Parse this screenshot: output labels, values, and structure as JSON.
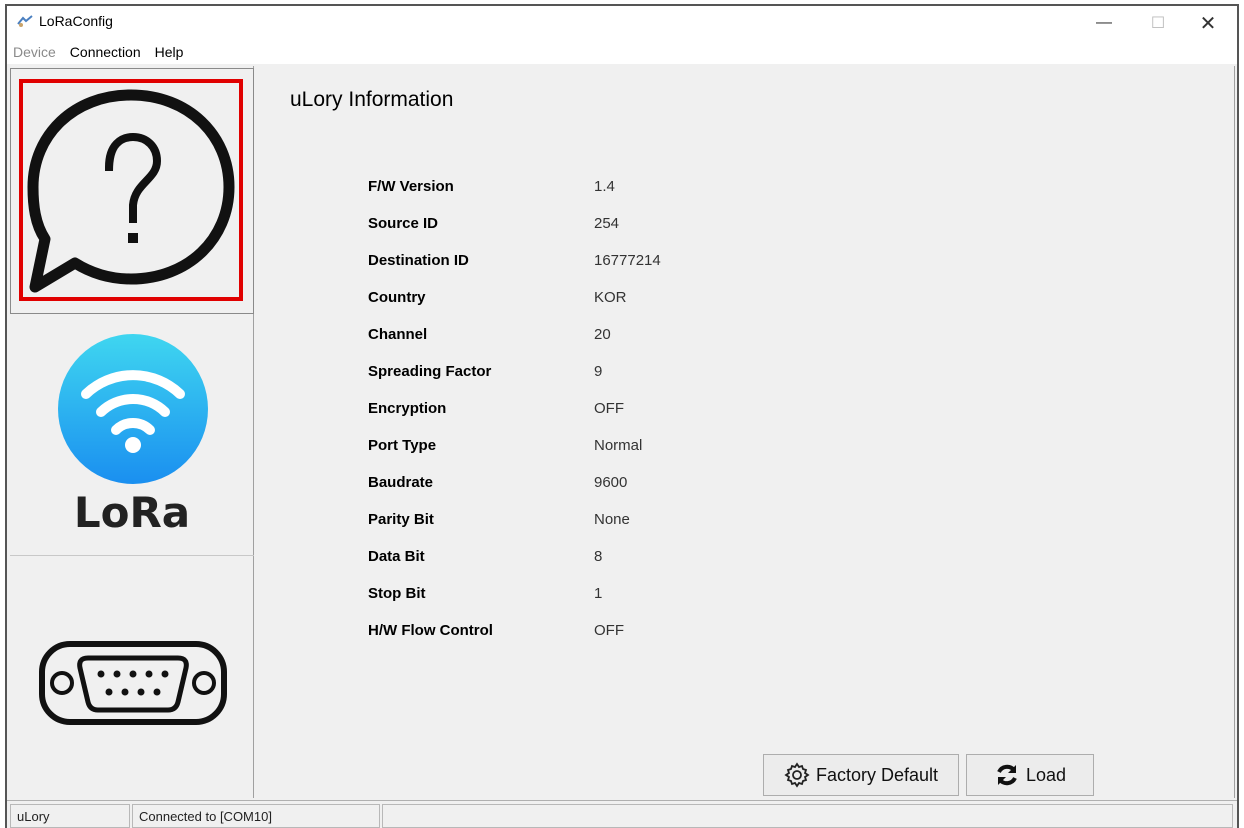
{
  "window": {
    "title": "LoRaConfig",
    "controls": {
      "minimize": "—",
      "maximize": "☐",
      "close": "✕"
    }
  },
  "menu": [
    {
      "label": "Device",
      "enabled": false
    },
    {
      "label": "Connection",
      "enabled": true
    },
    {
      "label": "Help",
      "enabled": true
    }
  ],
  "sidebar": {
    "items": [
      {
        "name": "help",
        "icon": "help-speech-bubble-icon",
        "selected": true
      },
      {
        "name": "lora",
        "icon": "lora-wifi-icon",
        "label": "LoRa"
      },
      {
        "name": "serial",
        "icon": "serial-port-icon"
      }
    ]
  },
  "main": {
    "title": "uLory Information",
    "rows": [
      {
        "label": "F/W Version",
        "value": "1.4"
      },
      {
        "label": "Source ID",
        "value": "254"
      },
      {
        "label": "Destination ID",
        "value": "16777214"
      },
      {
        "label": "Country",
        "value": "KOR"
      },
      {
        "label": "Channel",
        "value": "20"
      },
      {
        "label": "Spreading Factor",
        "value": "9"
      },
      {
        "label": "Encryption",
        "value": "OFF"
      },
      {
        "label": "Port Type",
        "value": "Normal"
      },
      {
        "label": "Baudrate",
        "value": "9600"
      },
      {
        "label": "Parity Bit",
        "value": "None"
      },
      {
        "label": "Data Bit",
        "value": "8"
      },
      {
        "label": "Stop Bit",
        "value": "1"
      },
      {
        "label": "H/W Flow Control",
        "value": "OFF"
      }
    ],
    "buttons": {
      "factory_default": "Factory Default",
      "load": "Load"
    }
  },
  "status": {
    "device": "uLory",
    "connection": "Connected to [COM10]"
  },
  "colors": {
    "selection_border": "#e00000",
    "lora_gradient_top": "#3fd6f0",
    "lora_gradient_bottom": "#1a8ff0"
  }
}
